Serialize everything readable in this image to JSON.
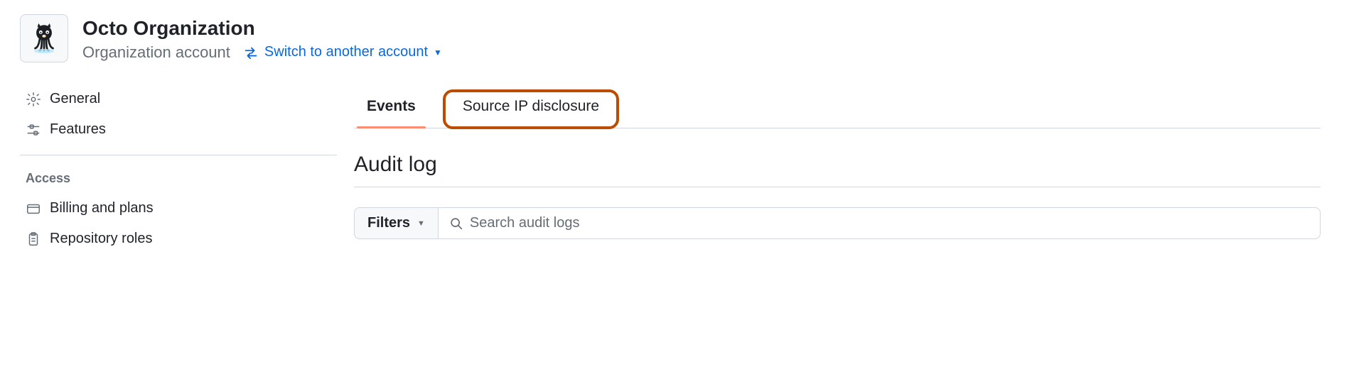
{
  "header": {
    "org_name": "Octo Organization",
    "account_type": "Organization account",
    "switch_label": "Switch to another account"
  },
  "sidebar": {
    "items": [
      {
        "label": "General"
      },
      {
        "label": "Features"
      }
    ],
    "access_section_title": "Access",
    "access_items": [
      {
        "label": "Billing and plans"
      },
      {
        "label": "Repository roles"
      }
    ]
  },
  "main": {
    "tabs": [
      {
        "label": "Events",
        "active": true
      },
      {
        "label": "Source IP disclosure",
        "highlighted": true
      }
    ],
    "heading": "Audit log",
    "filters_label": "Filters",
    "search_placeholder": "Search audit logs"
  }
}
